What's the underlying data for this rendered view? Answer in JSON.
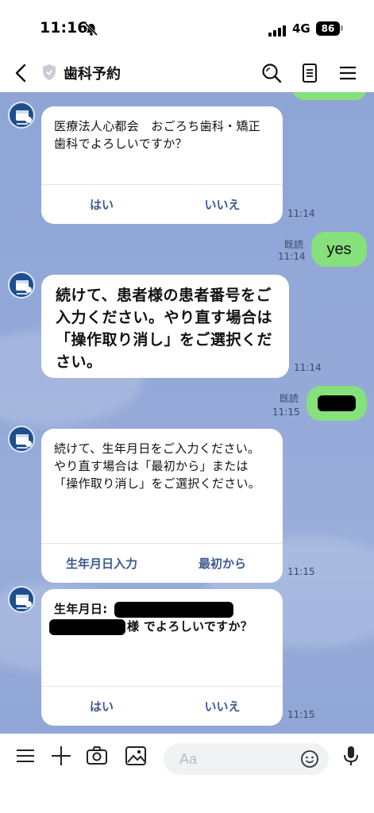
{
  "status": {
    "time": "11:16",
    "network": "4G",
    "battery": "86"
  },
  "header": {
    "title": "歯科予約"
  },
  "messages": [
    {
      "text": "医療法人心都会　おごろち歯科・矯正歯科でよろしいですか？",
      "actions": [
        "はい",
        "いいえ"
      ],
      "time": "11:14"
    },
    {
      "text": "yes",
      "read": "既読",
      "time": "11:14"
    },
    {
      "text": "続けて、患者様の患者番号をご入力ください。やり直す場合は「操作取り消し」をご選択ください。",
      "time": "11:14"
    },
    {
      "read": "既読",
      "time": "11:15"
    },
    {
      "text": "続けて、生年月日をご入力ください。やり直す場合は「最初から」または「操作取り消し」をご選択ください。",
      "actions": [
        "生年月日入力",
        "最初から"
      ],
      "time": "11:15"
    },
    {
      "label": "生年月日:",
      "text_suffix": "様 でよろしいですか？",
      "actions": [
        "はい",
        "いいえ"
      ],
      "time": "11:15"
    }
  ],
  "input": {
    "placeholder": "Aa"
  },
  "colors": {
    "chat_bg": "#8ea5d6",
    "sent_bubble": "#86e07c",
    "action_text": "#3b5a8f",
    "avatar": "#1f4e8c"
  }
}
